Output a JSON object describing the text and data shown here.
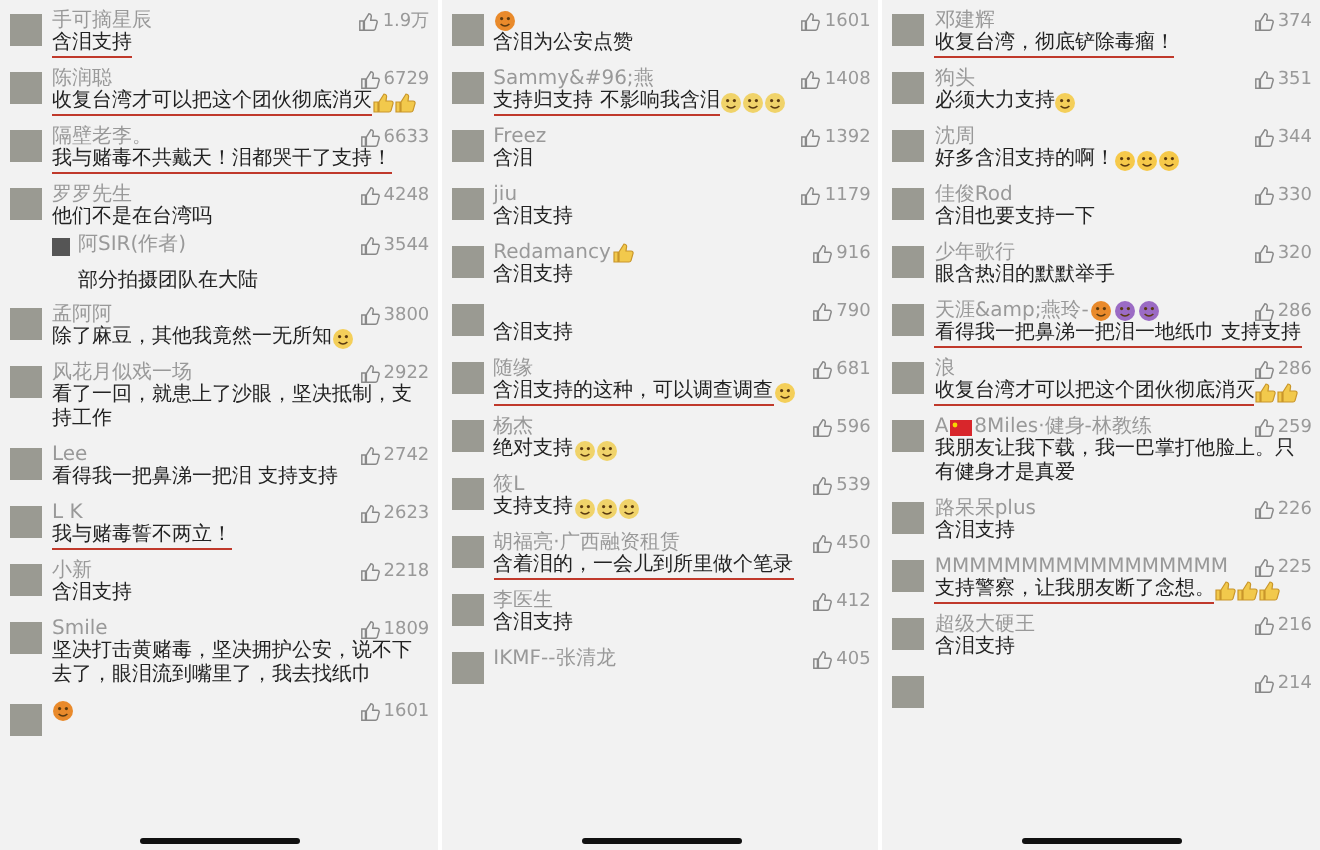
{
  "columns": [
    {
      "comments": [
        {
          "name": "手可摘星辰",
          "text": "含泪支持",
          "likes": "1.9万",
          "underlined": true
        },
        {
          "name": "陈润聪",
          "text": "收复台湾才可以把这个团伙彻底消灭",
          "reactions": [
            {
              "kind": "thumbs"
            },
            {
              "kind": "thumbs"
            }
          ],
          "likes": "6729",
          "underlined": true
        },
        {
          "name": "隔壁老李。",
          "text": "我与赌毒不共戴天！泪都哭干了支持！",
          "likes": "6633",
          "underlined": true
        },
        {
          "name": "罗罗先生",
          "text": "他们不是在台湾吗",
          "likes": "4248",
          "underlined": false,
          "replies": [
            {
              "name": "阿SIR(作者)",
              "text": "部分拍摄团队在大陆",
              "likes": "3544"
            }
          ]
        },
        {
          "name": "孟阿阿",
          "text": "除了麻豆，其他我竟然一无所知",
          "reactions": [
            {
              "kind": "smile"
            }
          ],
          "likes": "3800",
          "underlined": false
        },
        {
          "name": "风花月似戏一场",
          "text": "看了一回，就患上了沙眼，坚决抵制，支持工作",
          "likes": "2922",
          "underlined": false
        },
        {
          "name": "Lee",
          "text": "看得我一把鼻涕一把泪 支持支持",
          "likes": "2742",
          "underlined": false
        },
        {
          "name": "L K",
          "text": "我与赌毒誓不两立！",
          "likes": "2623",
          "underlined": true
        },
        {
          "name": "小新",
          "text": "含泪支持",
          "likes": "2218",
          "underlined": false
        },
        {
          "name": "Smile",
          "text": "坚决打击黄赌毒，坚决拥护公安，说不下去了，眼泪流到嘴里了，我去找纸巾",
          "likes": "1809",
          "underlined": false
        },
        {
          "name_reactions": [
            {
              "kind": "orange"
            }
          ],
          "likes": "1601"
        }
      ]
    },
    {
      "comments": [
        {
          "name_reactions": [
            {
              "kind": "orange"
            }
          ],
          "text": "含泪为公安点赞",
          "likes": "1601",
          "underlined": false
        },
        {
          "name": "Sammy&#96;燕",
          "text": "支持归支持 不影响我含泪",
          "reactions": [
            {
              "kind": "cry"
            },
            {
              "kind": "cry"
            },
            {
              "kind": "cry"
            }
          ],
          "likes": "1408",
          "underlined": true
        },
        {
          "name": "Freez",
          "text": "含泪",
          "likes": "1392",
          "underlined": false
        },
        {
          "name": "jiu",
          "text": "含泪支持",
          "likes": "1179",
          "underlined": false
        },
        {
          "name": "Redamancy",
          "name_reactions": [
            {
              "kind": "thumbs"
            }
          ],
          "text": "含泪支持",
          "likes": "916",
          "underlined": false
        },
        {
          "text": "含泪支持",
          "likes": "790",
          "underlined": false
        },
        {
          "name": "随缘",
          "text": "含泪支持的这种，可以调查调查",
          "reactions": [
            {
              "kind": "smile"
            }
          ],
          "likes": "681",
          "underlined": true
        },
        {
          "name": "杨杰",
          "text": "绝对支持",
          "reactions": [
            {
              "kind": "cry"
            },
            {
              "kind": "cry"
            }
          ],
          "likes": "596",
          "underlined": false
        },
        {
          "name": "筱L",
          "text": "支持支持",
          "reactions": [
            {
              "kind": "cry"
            },
            {
              "kind": "cry"
            },
            {
              "kind": "cry"
            }
          ],
          "likes": "539",
          "underlined": false
        },
        {
          "name": "胡福亮·广西融资租赁",
          "text": "含着泪的，一会儿到所里做个笔录",
          "likes": "450",
          "underlined": true
        },
        {
          "name": "李医生",
          "text": "含泪支持",
          "likes": "412",
          "underlined": false
        },
        {
          "name": "IKMF--张清龙",
          "likes": "405"
        }
      ]
    },
    {
      "comments": [
        {
          "name": "邓建辉",
          "text": "收复台湾，彻底铲除毒瘤！",
          "likes": "374",
          "underlined": true
        },
        {
          "name": "狗头",
          "text": "必须大力支持",
          "reactions": [
            {
              "kind": "smile"
            }
          ],
          "likes": "351",
          "underlined": false
        },
        {
          "name": "沈周",
          "text": "好多含泪支持的啊！",
          "reactions": [
            {
              "kind": "grin"
            },
            {
              "kind": "grin"
            },
            {
              "kind": "grin"
            }
          ],
          "likes": "344",
          "underlined": false
        },
        {
          "name": "佳俊Rod",
          "text": "含泪也要支持一下",
          "likes": "330",
          "underlined": false
        },
        {
          "name": "少年歌行",
          "text": "眼含热泪的默默举手",
          "likes": "320",
          "underlined": false
        },
        {
          "name": "天涯&amp;燕玲-",
          "name_reactions": [
            {
              "kind": "orange"
            },
            {
              "kind": "devil"
            },
            {
              "kind": "devil"
            }
          ],
          "text": "看得我一把鼻涕一把泪一地纸巾 支持支持",
          "likes": "286",
          "underlined": true
        },
        {
          "name": "浪",
          "text": "收复台湾才可以把这个团伙彻底消灭",
          "reactions": [
            {
              "kind": "thumbs"
            },
            {
              "kind": "thumbs"
            }
          ],
          "likes": "286",
          "underlined": true
        },
        {
          "name": "A",
          "name_reactions": [
            {
              "kind": "flag"
            }
          ],
          "name_suffix": "8Miles·健身-林教练",
          "text": "我朋友让我下载，我一巴掌打他脸上。只有健身才是真爱",
          "likes": "259",
          "underlined": false
        },
        {
          "name": "路呆呆plus",
          "text": "含泪支持",
          "likes": "226",
          "underlined": false
        },
        {
          "name": "MMMMMMMMMMMMMMMMM",
          "text": "支持警察，让我朋友断了念想。",
          "reactions": [
            {
              "kind": "thumbs"
            },
            {
              "kind": "thumbs"
            },
            {
              "kind": "thumbs"
            }
          ],
          "likes": "225",
          "underlined": true
        },
        {
          "name": "超级大硬王",
          "text": "含泪支持",
          "likes": "216",
          "underlined": false
        },
        {
          "likes": "214"
        }
      ]
    }
  ]
}
